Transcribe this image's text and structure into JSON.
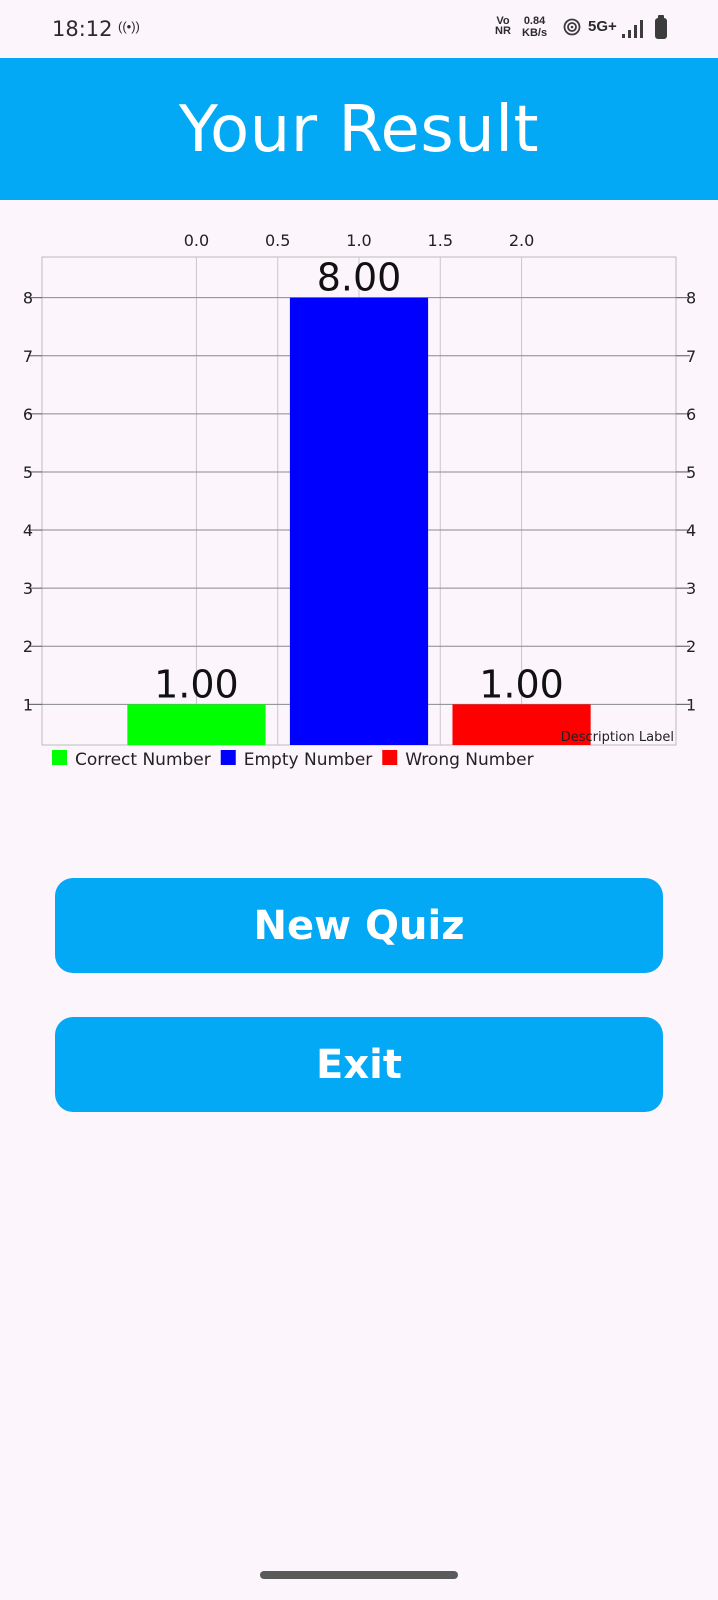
{
  "status_bar": {
    "time": "18:12",
    "volte_top": "Vo",
    "volte_bottom": "NR",
    "speed_value": "0.84",
    "speed_unit": "KB/s",
    "network": "5G+",
    "icons": [
      "hotspot-icon",
      "wifi-icon",
      "signal-icon",
      "battery-icon"
    ]
  },
  "header": {
    "title": "Your Result"
  },
  "chart_data": {
    "type": "bar",
    "categories": [
      "Correct Number",
      "Empty Number",
      "Wrong Number"
    ],
    "x": [
      0.0,
      1.0,
      2.0
    ],
    "values": [
      1.0,
      8.0,
      1.0
    ],
    "value_labels": [
      "1.00",
      "8.00",
      "1.00"
    ],
    "colors": [
      "#00ff00",
      "#0000ff",
      "#ff0000"
    ],
    "x_ticks": [
      "0.0",
      "0.5",
      "1.0",
      "1.5",
      "2.0"
    ],
    "x_tick_values": [
      0.0,
      0.5,
      1.0,
      1.5,
      2.0
    ],
    "y_ticks": [
      "1",
      "2",
      "3",
      "4",
      "5",
      "6",
      "7",
      "8"
    ],
    "y_tick_values": [
      1,
      2,
      3,
      4,
      5,
      6,
      7,
      8
    ],
    "xlim": [
      -0.95,
      2.95
    ],
    "ylim": [
      0.3,
      8.7
    ],
    "description": "Description Label",
    "legend_position": "bottom-left",
    "grid": true
  },
  "buttons": {
    "new_quiz": "New Quiz",
    "exit": "Exit"
  }
}
